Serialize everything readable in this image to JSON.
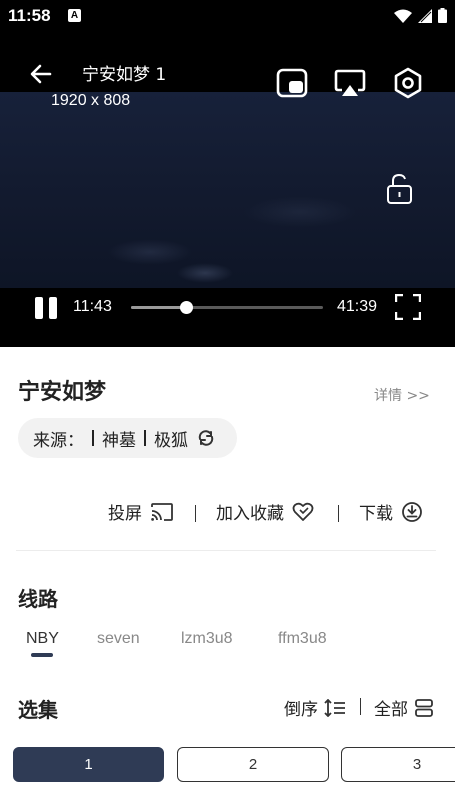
{
  "status_bar": {
    "time": "11:58",
    "notification_badge": "A"
  },
  "player": {
    "title": "宁安如梦 1",
    "resolution": "1920 x 808",
    "current_time": "11:43",
    "total_time": "41:39",
    "progress_fraction": 0.29
  },
  "show": {
    "title": "宁安如梦",
    "detail_link": "详情 >>",
    "source_label": "来源：",
    "sources": [
      "神墓",
      "极狐"
    ]
  },
  "actions": {
    "cast": "投屏",
    "favorite": "加入收藏",
    "download": "下载"
  },
  "routes": {
    "heading": "线路",
    "items": [
      "NBY",
      "seven",
      "lzm3u8",
      "ffm3u8"
    ],
    "selected_index": 0
  },
  "episodes": {
    "heading": "选集",
    "sort_label": "倒序",
    "all_label": "全部",
    "items": [
      "1",
      "2",
      "3"
    ],
    "selected_index": 0
  },
  "colors": {
    "accent": "#2f3b55",
    "player_bg": "#000000",
    "text_primary": "#222222",
    "text_muted": "#888888"
  }
}
